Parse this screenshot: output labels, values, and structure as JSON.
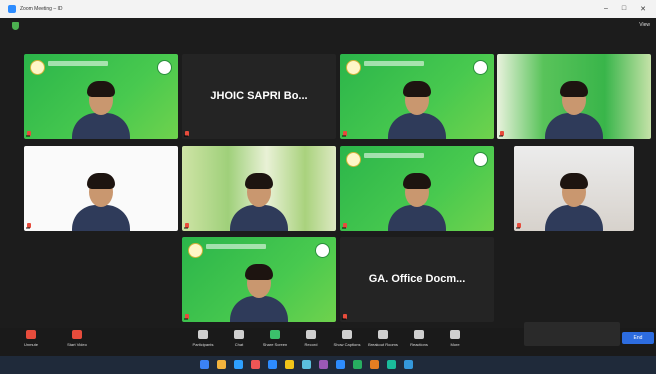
{
  "window": {
    "title": "Zoom Meeting – ID",
    "controls": [
      "–",
      "□",
      "✕"
    ]
  },
  "topbar": {
    "view_label": "View"
  },
  "tiles": [
    {
      "name": "tile-1",
      "style": "green",
      "nametag": "",
      "person": true,
      "logos": true
    },
    {
      "name": "tile-2",
      "style": "dark",
      "nametag": "",
      "big_name": "JHOIC SAPRI Bo..."
    },
    {
      "name": "tile-3",
      "style": "green",
      "nametag": "",
      "person": true,
      "logos": true
    },
    {
      "name": "tile-4",
      "style": "mixed",
      "nametag": "",
      "person": true
    },
    {
      "name": "tile-5",
      "style": "bright",
      "nametag": "",
      "person": true
    },
    {
      "name": "tile-6",
      "style": "plant",
      "nametag": "",
      "person": true
    },
    {
      "name": "tile-7",
      "style": "green",
      "nametag": "",
      "person": true,
      "logos": true
    },
    {
      "name": "tile-8",
      "style": "room",
      "nametag": "",
      "person": true
    },
    {
      "name": "tile-9",
      "style": "green",
      "nametag": "",
      "person": true,
      "logos": true
    },
    {
      "name": "tile-10",
      "style": "dark",
      "nametag": "",
      "big_name": "GA. Office Docm..."
    }
  ],
  "controls": {
    "left": [
      {
        "name": "unmute-button",
        "label": "Unmute",
        "color": "red"
      },
      {
        "name": "start-video-button",
        "label": "Start Video",
        "color": "red"
      }
    ],
    "center": [
      {
        "name": "participants-button",
        "label": "Participants",
        "color": "grey"
      },
      {
        "name": "chat-button",
        "label": "Chat",
        "color": "grey"
      },
      {
        "name": "share-screen-button",
        "label": "Share Screen",
        "color": "green"
      },
      {
        "name": "record-button",
        "label": "Record",
        "color": "grey"
      },
      {
        "name": "show-captions-button",
        "label": "Show Captions",
        "color": "grey"
      },
      {
        "name": "breakout-rooms-button",
        "label": "Breakout Rooms",
        "color": "grey"
      },
      {
        "name": "reactions-button",
        "label": "Reactions",
        "color": "grey"
      },
      {
        "name": "more-button",
        "label": "More",
        "color": "grey"
      }
    ],
    "end_label": "End"
  },
  "chat_preview": "",
  "taskbar": {
    "left_text": "",
    "time": "",
    "date": ""
  }
}
